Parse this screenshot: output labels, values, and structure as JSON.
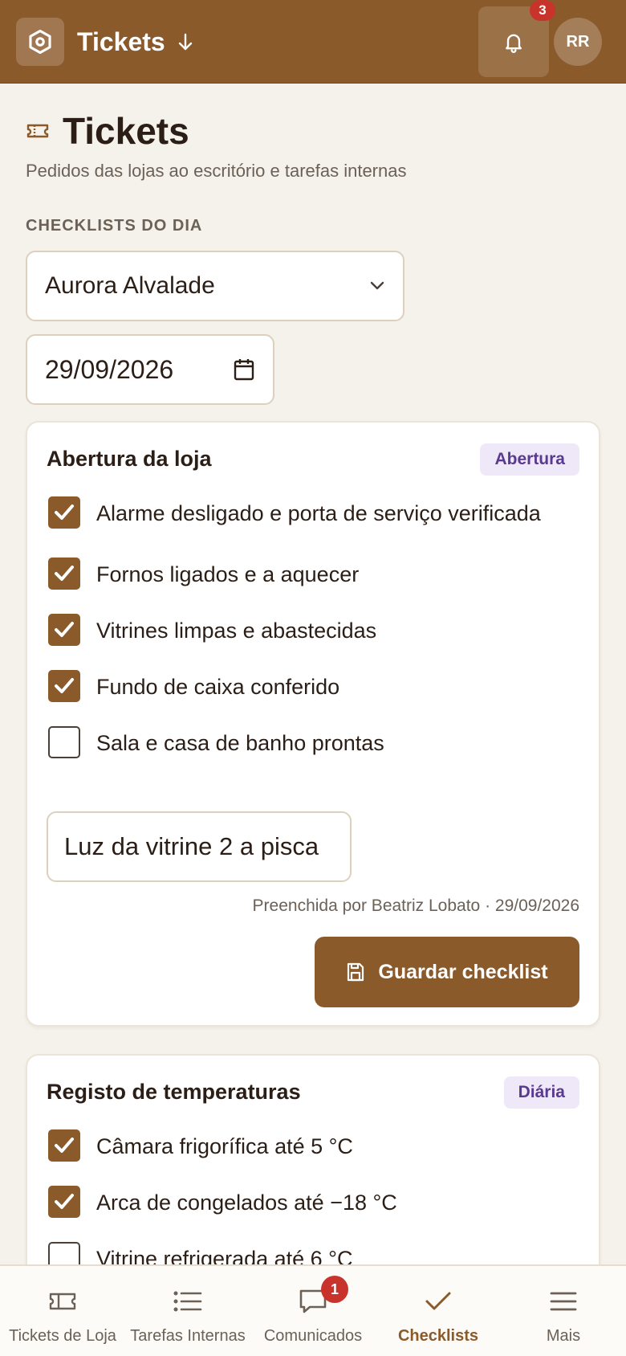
{
  "topbar": {
    "title": "Tickets",
    "notification_count": "3",
    "avatar_initials": "RR"
  },
  "page": {
    "title": "Tickets",
    "subtitle": "Pedidos das lojas ao escritório e tarefas internas",
    "section_label": "CHECKLISTS DO DIA"
  },
  "filters": {
    "store": "Aurora Alvalade",
    "date": "29/09/2026"
  },
  "checklists": [
    {
      "title": "Abertura da loja",
      "tag": "Abertura",
      "items": [
        {
          "label": "Alarme desligado e porta de serviço verificada",
          "checked": true
        },
        {
          "label": "Fornos ligados e a aquecer",
          "checked": true
        },
        {
          "label": "Vitrines limpas e abastecidas",
          "checked": true
        },
        {
          "label": "Fundo de caixa conferido",
          "checked": true
        },
        {
          "label": "Sala e casa de banho prontas",
          "checked": false
        }
      ],
      "note": "Luz da vitrine 2 a pisca",
      "filled_by": "Preenchida por Beatriz Lobato · 29/09/2026",
      "save_label": "Guardar checklist"
    },
    {
      "title": "Registo de temperaturas",
      "tag": "Diária",
      "items": [
        {
          "label": "Câmara frigorífica até 5 °C",
          "checked": true
        },
        {
          "label": "Arca de congelados até −18 °C",
          "checked": true
        },
        {
          "label": "Vitrine refrigerada até 6 °C",
          "checked": false
        }
      ]
    }
  ],
  "bottom_nav": {
    "items": [
      {
        "label": "Tickets de Loja",
        "icon": "ticket-icon"
      },
      {
        "label": "Tarefas Internas",
        "icon": "list-icon"
      },
      {
        "label": "Comunicados",
        "icon": "chat-icon",
        "badge": "1"
      },
      {
        "label": "Checklists",
        "icon": "check-icon",
        "active": true
      },
      {
        "label": "Mais",
        "icon": "menu-icon"
      }
    ]
  },
  "colors": {
    "brand": "#8b5a2b",
    "background": "#f5f1eb",
    "badge": "#c8342b",
    "tag_bg": "#efe8f8",
    "tag_text": "#5a3a91"
  }
}
